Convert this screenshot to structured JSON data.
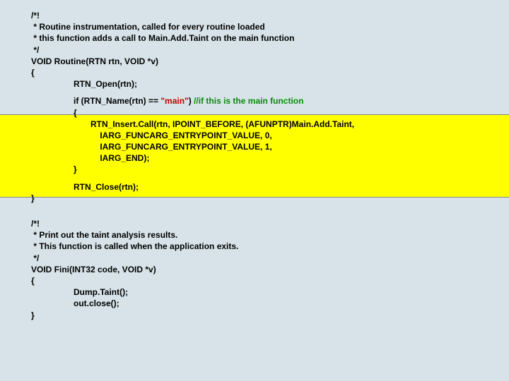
{
  "routine": {
    "c1": "/*!",
    "c2": " * Routine instrumentation, called for every routine loaded",
    "c3": " * this function adds a call to Main.Add.Taint on the main function",
    "c4": " */",
    "sig": "VOID Routine(RTN rtn, VOID *v)",
    "open_brace": "{",
    "rtn_open": "RTN_Open(rtn);",
    "if_prefix": "if (RTN_Name(rtn) == ",
    "if_string": "\"main\"",
    "if_paren_close": ") ",
    "if_comment": "//if this is the main function",
    "if_open": "{",
    "insert1": "RTN_Insert.Call(rtn, IPOINT_BEFORE, (AFUNPTR)Main.Add.Taint,",
    "insert2": "    IARG_FUNCARG_ENTRYPOINT_VALUE, 0,",
    "insert3": "    IARG_FUNCARG_ENTRYPOINT_VALUE, 1,",
    "insert4": "    IARG_END);",
    "if_close": "}",
    "rtn_close": "RTN_Close(rtn);",
    "close_brace": "}"
  },
  "fini": {
    "c1": "/*!",
    "c2": " * Print out the taint analysis results.",
    "c3": " * This function is called when the application exits.",
    "c4": " */",
    "sig": "VOID Fini(INT32 code, VOID *v)",
    "open_brace": "{",
    "dump": "Dump.Taint();",
    "close": "out.close();",
    "close_brace": "}"
  }
}
